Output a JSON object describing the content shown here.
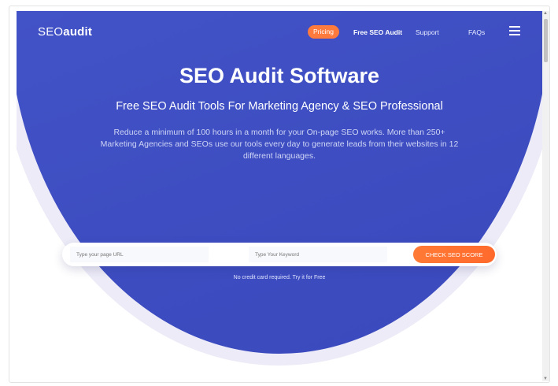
{
  "nav": {
    "logo_prefix": "SEO",
    "logo_suffix": "audit",
    "pricing": "Pricing",
    "free_audit": "Free SEO Audit",
    "support": "Support",
    "faqs": "FAQs",
    "menu_icon": "hamburger-menu-icon"
  },
  "hero": {
    "title": "SEO Audit Software",
    "subtitle": "Free SEO Audit Tools For Marketing Agency & SEO Professional",
    "description": "Reduce a minimum of 100 hours in a month for your On-page SEO works. More than 250+ Marketing Agencies and SEOs use our tools every day to generate leads from their websites in 12 different languages."
  },
  "form": {
    "url_placeholder": "Type your page URL",
    "keyword_placeholder": "Type Your Keyword",
    "button": "CHECK SEO SCORE",
    "note": "No credit card required. Try it for Free"
  },
  "colors": {
    "hero": "#4152c6",
    "accent": "#ff7a3d",
    "halo": "#ecebf7"
  }
}
